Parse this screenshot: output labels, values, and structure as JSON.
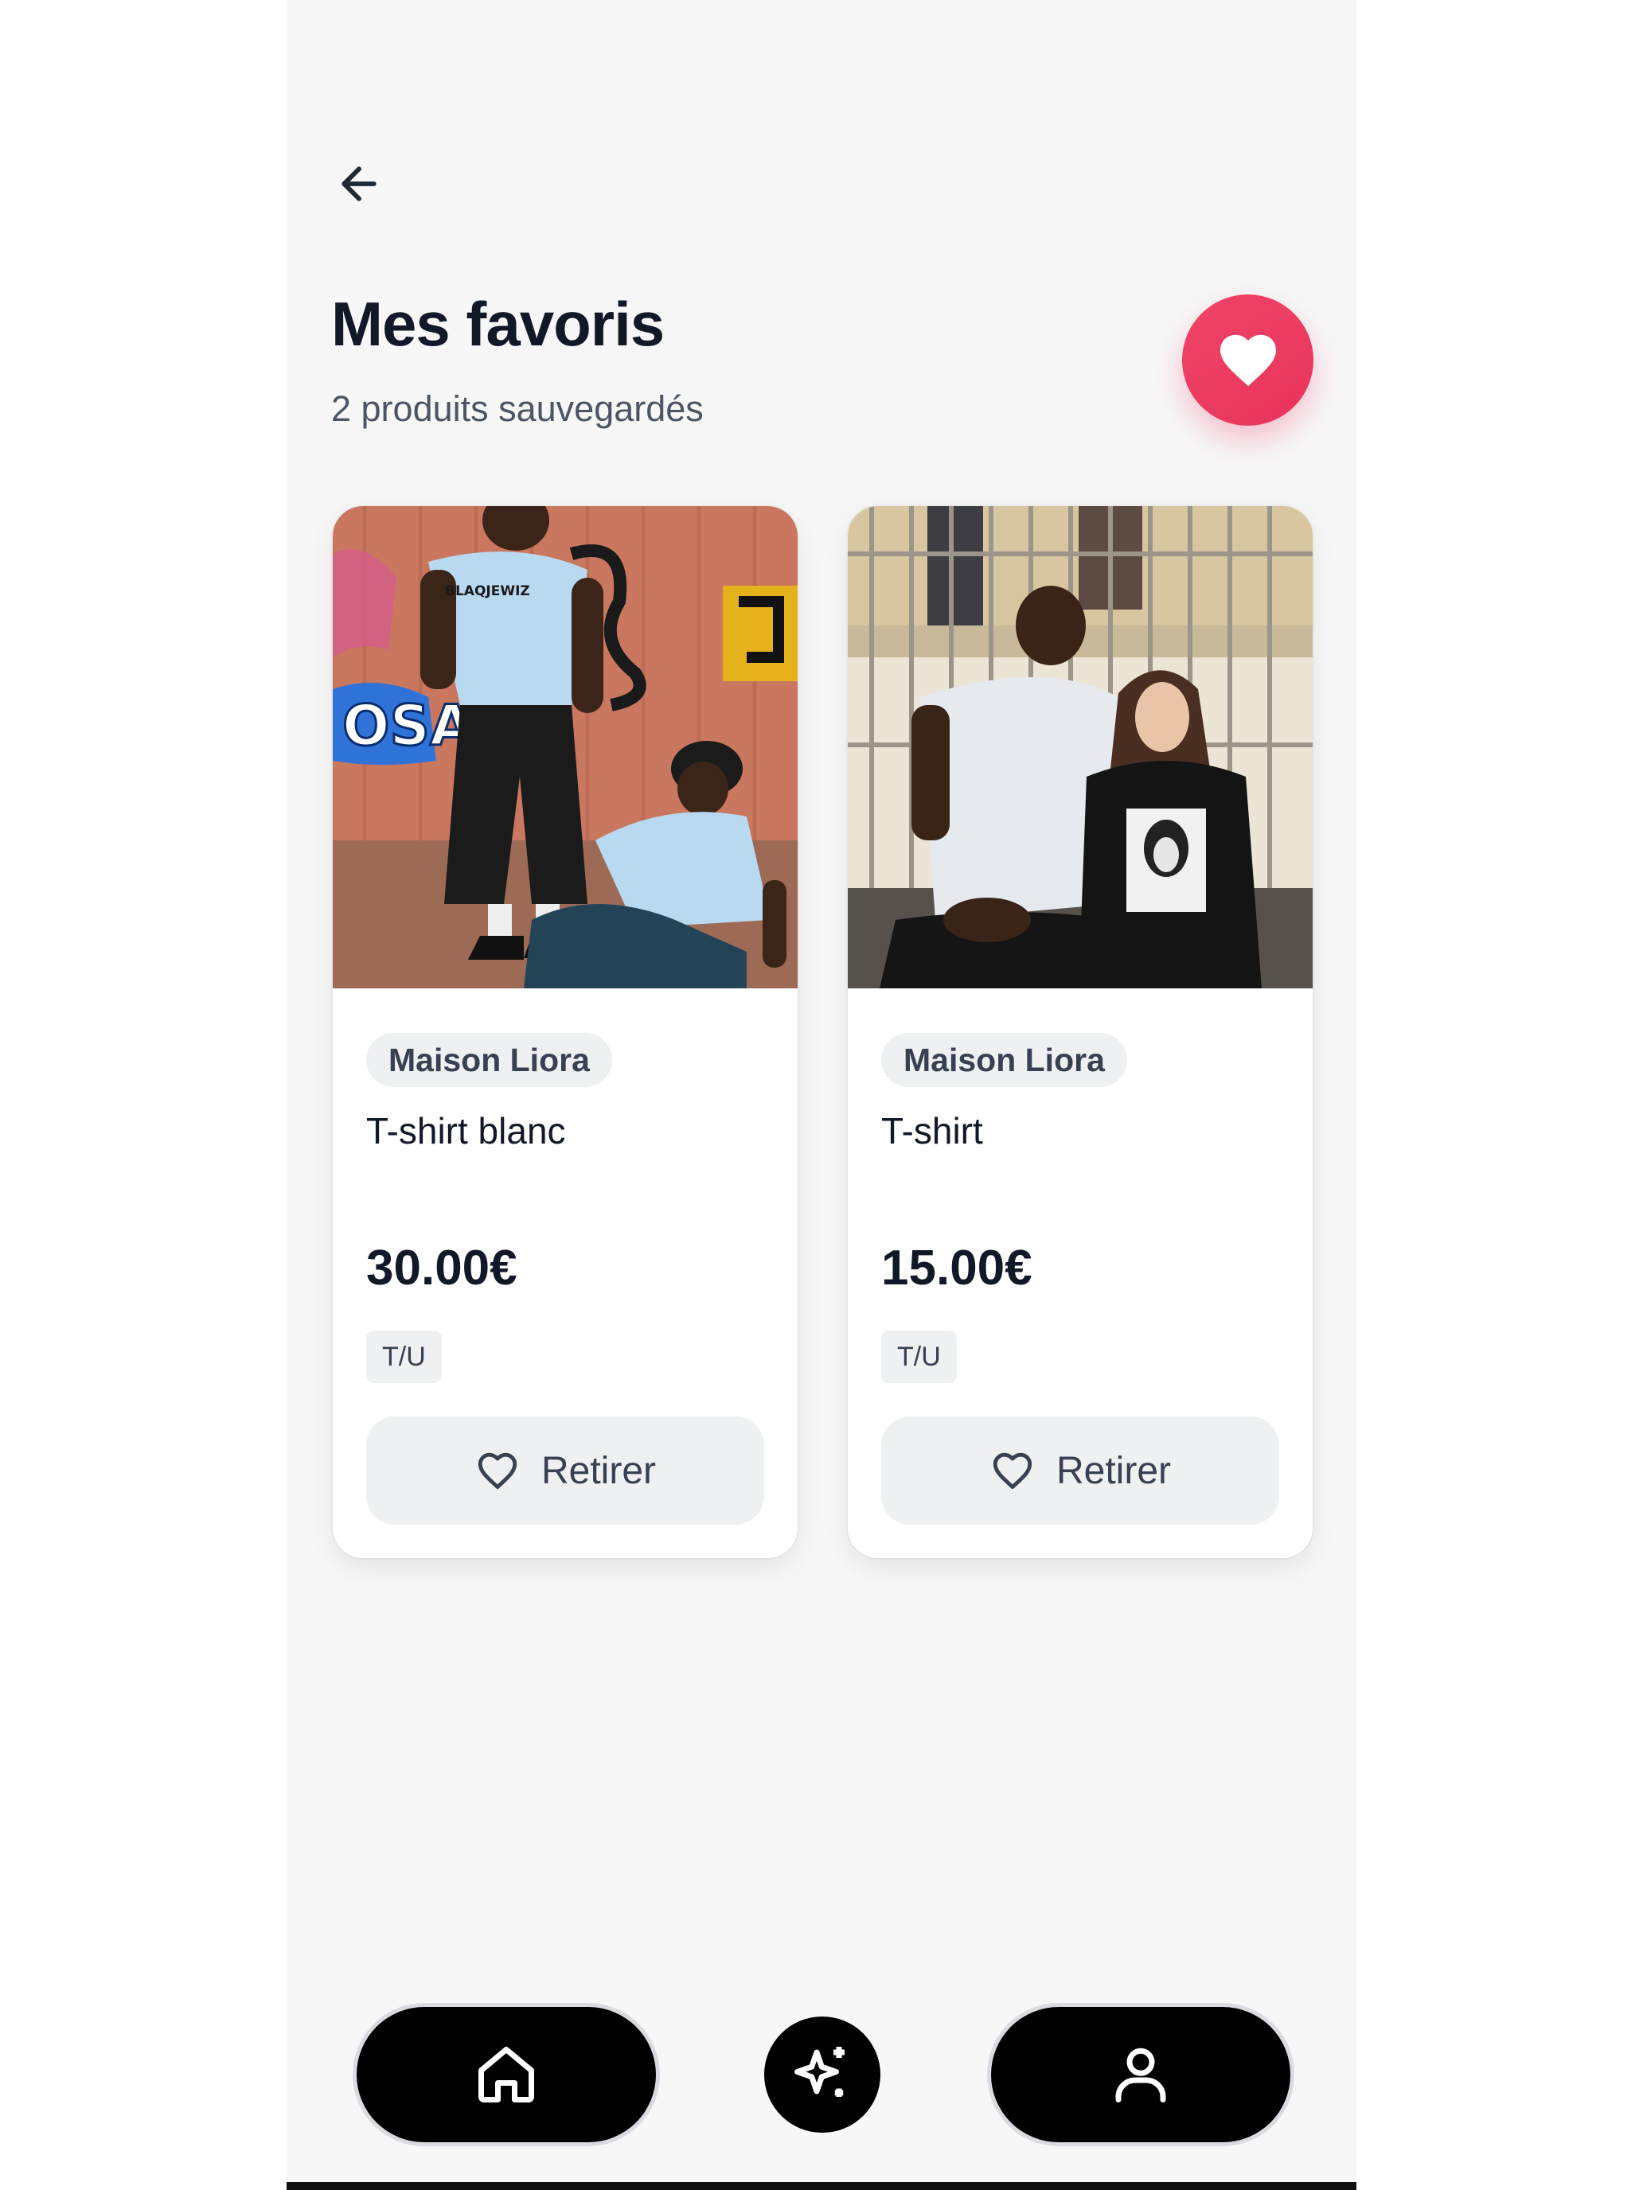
{
  "header": {
    "back_icon": "arrow-left-icon",
    "title": "Mes favoris",
    "subtitle": "2 produits sauvegardés",
    "badge_icon": "heart-filled-icon"
  },
  "products": [
    {
      "brand": "Maison Liora",
      "name": "T-shirt blanc",
      "price": "30.00€",
      "size": "T/U",
      "remove_label": "Retirer",
      "remove_icon": "heart-outline-icon",
      "shirt_text": "BLAQJEWIZ"
    },
    {
      "brand": "Maison Liora",
      "name": "T-shirt",
      "price": "15.00€",
      "size": "T/U",
      "remove_label": "Retirer",
      "remove_icon": "heart-outline-icon"
    }
  ],
  "nav": {
    "items": [
      {
        "icon": "home-icon"
      },
      {
        "icon": "sparkles-icon"
      },
      {
        "icon": "user-icon"
      }
    ]
  },
  "colors": {
    "accent": "#e8335a",
    "text": "#111827",
    "muted": "#4b5563",
    "nav_bg": "#000000"
  }
}
